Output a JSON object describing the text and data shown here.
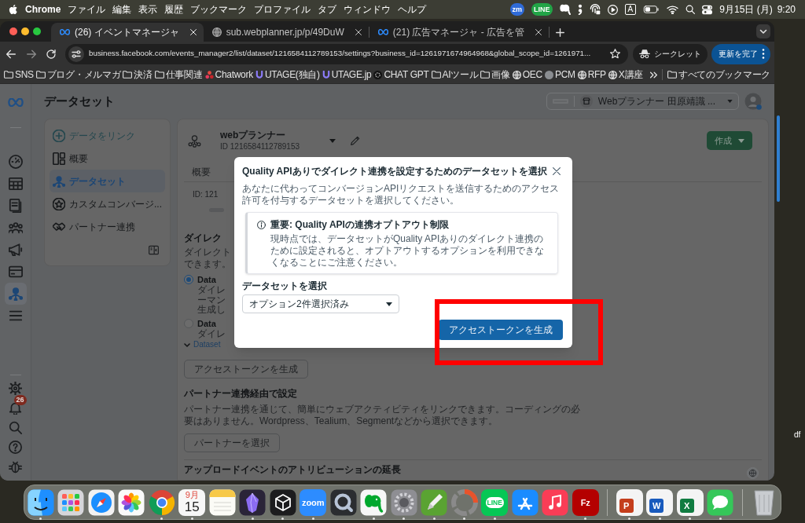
{
  "menu_bar": {
    "app_name": "Chrome",
    "menus": [
      "ファイル",
      "編集",
      "表示",
      "履歴",
      "ブックマーク",
      "プロファイル",
      "タブ",
      "ウィンドウ",
      "ヘルプ"
    ],
    "status_items": [
      {
        "kind": "badge",
        "text": "zm",
        "color": "#2f6bd8"
      },
      {
        "kind": "badge",
        "text": "LINE",
        "color": "#22a447"
      },
      {
        "kind": "elephant"
      },
      {
        "kind": "semicolon"
      },
      {
        "kind": "fingerprint"
      },
      {
        "kind": "play"
      },
      {
        "kind": "input",
        "text": "A"
      },
      {
        "kind": "battery"
      },
      {
        "kind": "wifi"
      },
      {
        "kind": "search"
      },
      {
        "kind": "toggles"
      }
    ],
    "date": "9月15日 (月)",
    "time": "9:20"
  },
  "browser": {
    "tabs": [
      {
        "kind": "meta",
        "title": "(26) イベントマネージャ",
        "selected": true
      },
      {
        "kind": "globe",
        "title": "sub.webplanner.jp/p/49DuW",
        "selected": false
      },
      {
        "kind": "meta",
        "title": "(21) 広告マネージャ - 広告を管",
        "selected": false
      }
    ],
    "url": "business.facebook.com/events_manager2/list/dataset/1216584112789153/settings?business_id=1261971674964968&global_scope_id=1261971...",
    "incognito_label": "シークレット",
    "update_label": "更新を完了",
    "bookmarks": [
      {
        "kind": "folder",
        "label": "SNS"
      },
      {
        "kind": "folder",
        "label": "ブログ・メルマガ"
      },
      {
        "kind": "folder",
        "label": "決済"
      },
      {
        "kind": "folder",
        "label": "仕事関連"
      },
      {
        "kind": "dots",
        "label": "Chatwork"
      },
      {
        "kind": "cup",
        "label": "UTAGE(独自)"
      },
      {
        "kind": "cup",
        "label": "UTAGE.jp"
      },
      {
        "kind": "knot",
        "label": "CHAT GPT"
      },
      {
        "kind": "folder",
        "label": "AIツール"
      },
      {
        "kind": "folder",
        "label": "画像"
      },
      {
        "kind": "globe",
        "label": "OEC"
      },
      {
        "kind": "avatar",
        "label": "PCM"
      },
      {
        "kind": "globe",
        "label": "RFP"
      },
      {
        "kind": "globe",
        "label": "X講座"
      }
    ],
    "all_bookmarks_label": "すべてのブックマーク"
  },
  "page": {
    "title": "データセット",
    "account": "Webプランナー 田原靖識 ...",
    "rail": {
      "items": [
        {
          "kind": "gauge",
          "selected": false
        },
        {
          "kind": "table",
          "selected": false
        },
        {
          "kind": "pages",
          "selected": false
        },
        {
          "kind": "people",
          "selected": false
        },
        {
          "kind": "megaphone",
          "selected": false
        },
        {
          "kind": "card",
          "selected": false
        },
        {
          "kind": "nodes",
          "selected": true
        },
        {
          "kind": "menu",
          "selected": false
        }
      ],
      "bottom_items": [
        {
          "kind": "gear"
        },
        {
          "kind": "bell",
          "badge": "26"
        },
        {
          "kind": "search"
        },
        {
          "kind": "help"
        },
        {
          "kind": "bug"
        }
      ]
    },
    "nav": [
      {
        "kind": "plus",
        "label": "データをリンク",
        "selected": false
      },
      {
        "kind": "panels",
        "label": "概要",
        "selected": false
      },
      {
        "kind": "nodes",
        "label": "データセット",
        "selected": true
      },
      {
        "kind": "star",
        "label": "カスタムコンバージ...",
        "selected": false
      },
      {
        "kind": "handshake",
        "label": "パートナー連携",
        "selected": false
      }
    ],
    "dataset": {
      "name": "webプランナー",
      "id": "ID 1216584112789153",
      "create_button": "作成",
      "tab": "概要",
      "id_line": "ID: 121"
    },
    "direct": {
      "heading": "ダイレク",
      "text_lines": [
        "ダイレクト",
        "できます。"
      ],
      "options": [
        {
          "title": "Data",
          "lines": [
            "ダイレ",
            "ーマン",
            "生成し"
          ],
          "selected": true
        },
        {
          "title": "Data",
          "lines": [
            "ダイレ"
          ],
          "selected": false
        }
      ],
      "more_link": "Dataset",
      "button": "アクセストークンを生成"
    },
    "partner": {
      "heading": "パートナー連携経由で設定",
      "text": "パートナー連携を通じて、簡単にウェブアクティビティをリンクできます。コーディングの必要はありません。Wordpress、Tealium、Segmentなどから選択できます。",
      "button": "パートナーを選択"
    },
    "next_heading": "アップロードイベントのアトリビューションの延長"
  },
  "modal": {
    "title": "Quality APIありでダイレクト連携を設定するためのデータセットを選択",
    "description": "あなたに代わってコンバージョンAPIリクエストを送信するためのアクセス許可を付与するデータセットを選択してください。",
    "notice": {
      "title": "重要: Quality APIの連携オプトアウト制限",
      "text": "現時点では、データセットがQuality APIありのダイレクト連携のために設定されると、オプトアウトするオプションを利用できなくなることにご注意ください。"
    },
    "select": {
      "label": "データセットを選択",
      "value": "オプション2件選択済み"
    },
    "button": "アクセストークンを生成"
  },
  "dock": {
    "sections": [
      [
        {
          "kind": "face",
          "running": true
        },
        {
          "kind": "grid",
          "running": false
        },
        {
          "kind": "compass",
          "running": false
        },
        {
          "kind": "flower",
          "running": false
        },
        {
          "kind": "segments",
          "running": true
        },
        {
          "kind": "calendar",
          "month": "9月",
          "day": "15",
          "running": true
        },
        {
          "kind": "notes",
          "running": false
        },
        {
          "kind": "crystal",
          "running": true
        },
        {
          "kind": "cube",
          "running": true
        },
        {
          "kind": "text_tile",
          "label": "zoom",
          "color": "#2d8cff",
          "running": true
        },
        {
          "kind": "lens",
          "running": false
        },
        {
          "kind": "elephant",
          "running": true
        },
        {
          "kind": "gear",
          "running": true
        },
        {
          "kind": "pen",
          "running": true
        },
        {
          "kind": "ring",
          "running": true
        },
        {
          "kind": "bubble_tile",
          "label": "LINE",
          "color": "#06c755",
          "running": true
        },
        {
          "kind": "store",
          "running": false
        },
        {
          "kind": "music",
          "running": false
        },
        {
          "kind": "text_tile",
          "label": "Fz",
          "color": "#b40000",
          "running": true
        }
      ],
      [
        {
          "kind": "office",
          "label": "P",
          "color": "#c43e1c",
          "running": true
        },
        {
          "kind": "office",
          "label": "W",
          "color": "#185abd",
          "running": true
        },
        {
          "kind": "office",
          "label": "X",
          "color": "#107c41",
          "running": true
        },
        {
          "kind": "speech",
          "running": true
        }
      ],
      [
        {
          "kind": "trash",
          "running": false
        }
      ]
    ]
  },
  "desktop": {
    "file_label": "df"
  }
}
